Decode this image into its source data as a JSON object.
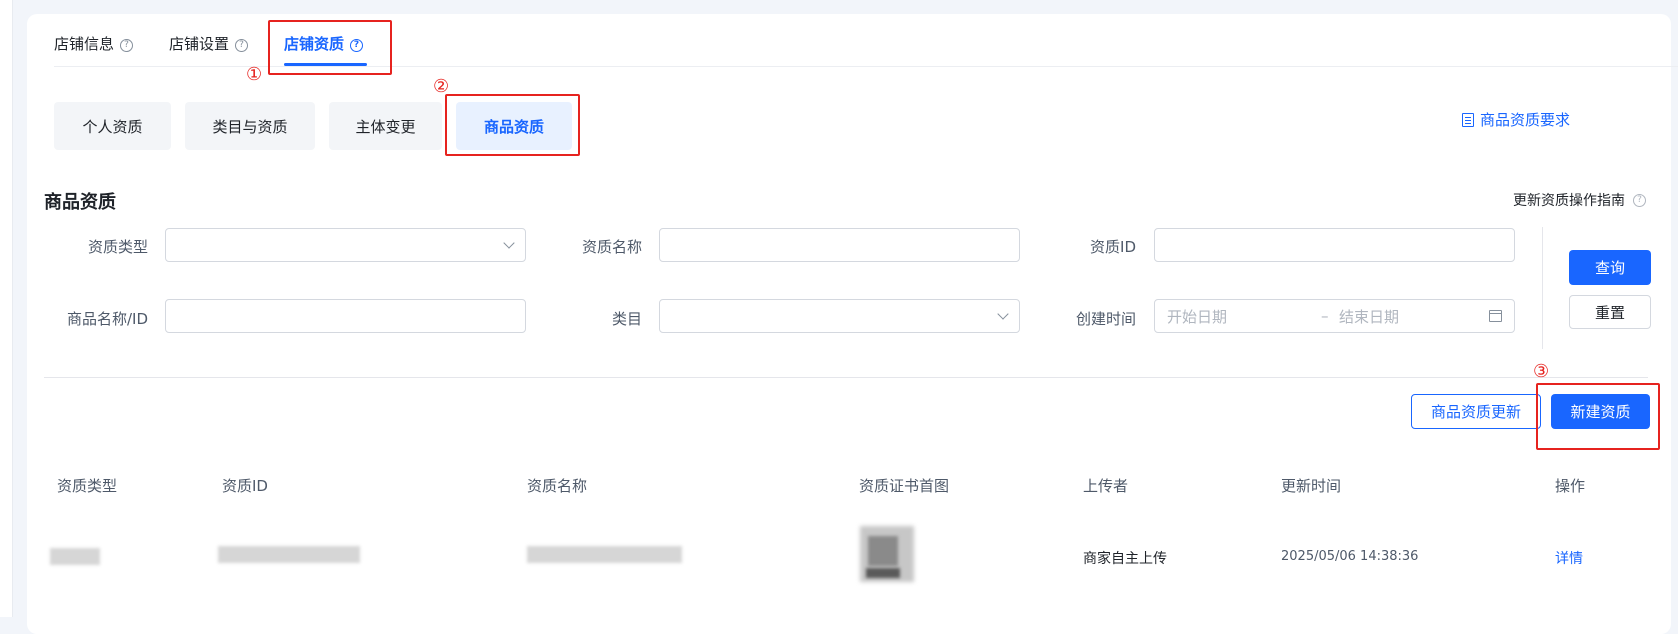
{
  "tabs": [
    {
      "label": "店铺信息",
      "active": false
    },
    {
      "label": "店铺设置",
      "active": false
    },
    {
      "label": "店铺资质",
      "active": true
    }
  ],
  "help_glyph": "?",
  "subtabs": [
    {
      "label": "个人资质",
      "active": false
    },
    {
      "label": "类目与资质",
      "active": false
    },
    {
      "label": "主体变更",
      "active": false
    },
    {
      "label": "商品资质",
      "active": true
    }
  ],
  "requirement_link": "商品资质要求",
  "section_title": "商品资质",
  "guide_link": "更新资质操作指南",
  "filters": {
    "qual_type_label": "资质类型",
    "qual_name_label": "资质名称",
    "qual_id_label": "资质ID",
    "product_label": "商品名称/ID",
    "category_label": "类目",
    "created_label": "创建时间",
    "start_placeholder": "开始日期",
    "range_sep": "–",
    "end_placeholder": "结束日期"
  },
  "buttons": {
    "query": "查询",
    "reset": "重置",
    "update_qual": "商品资质更新",
    "new_qual": "新建资质"
  },
  "table": {
    "columns": [
      "资质类型",
      "资质ID",
      "资质名称",
      "资质证书首图",
      "上传者",
      "更新时间",
      "操作"
    ],
    "rows": [
      {
        "uploader": "商家自主上传",
        "updated": "2025/05/06 14:38:36",
        "action": "详情"
      }
    ]
  },
  "annotations": [
    "①",
    "②",
    "③"
  ],
  "colors": {
    "accent": "#1966ff",
    "annotation": "#e6231f"
  },
  "icons": [
    "help-icon",
    "document-icon",
    "chevron-down-icon",
    "calendar-icon"
  ]
}
